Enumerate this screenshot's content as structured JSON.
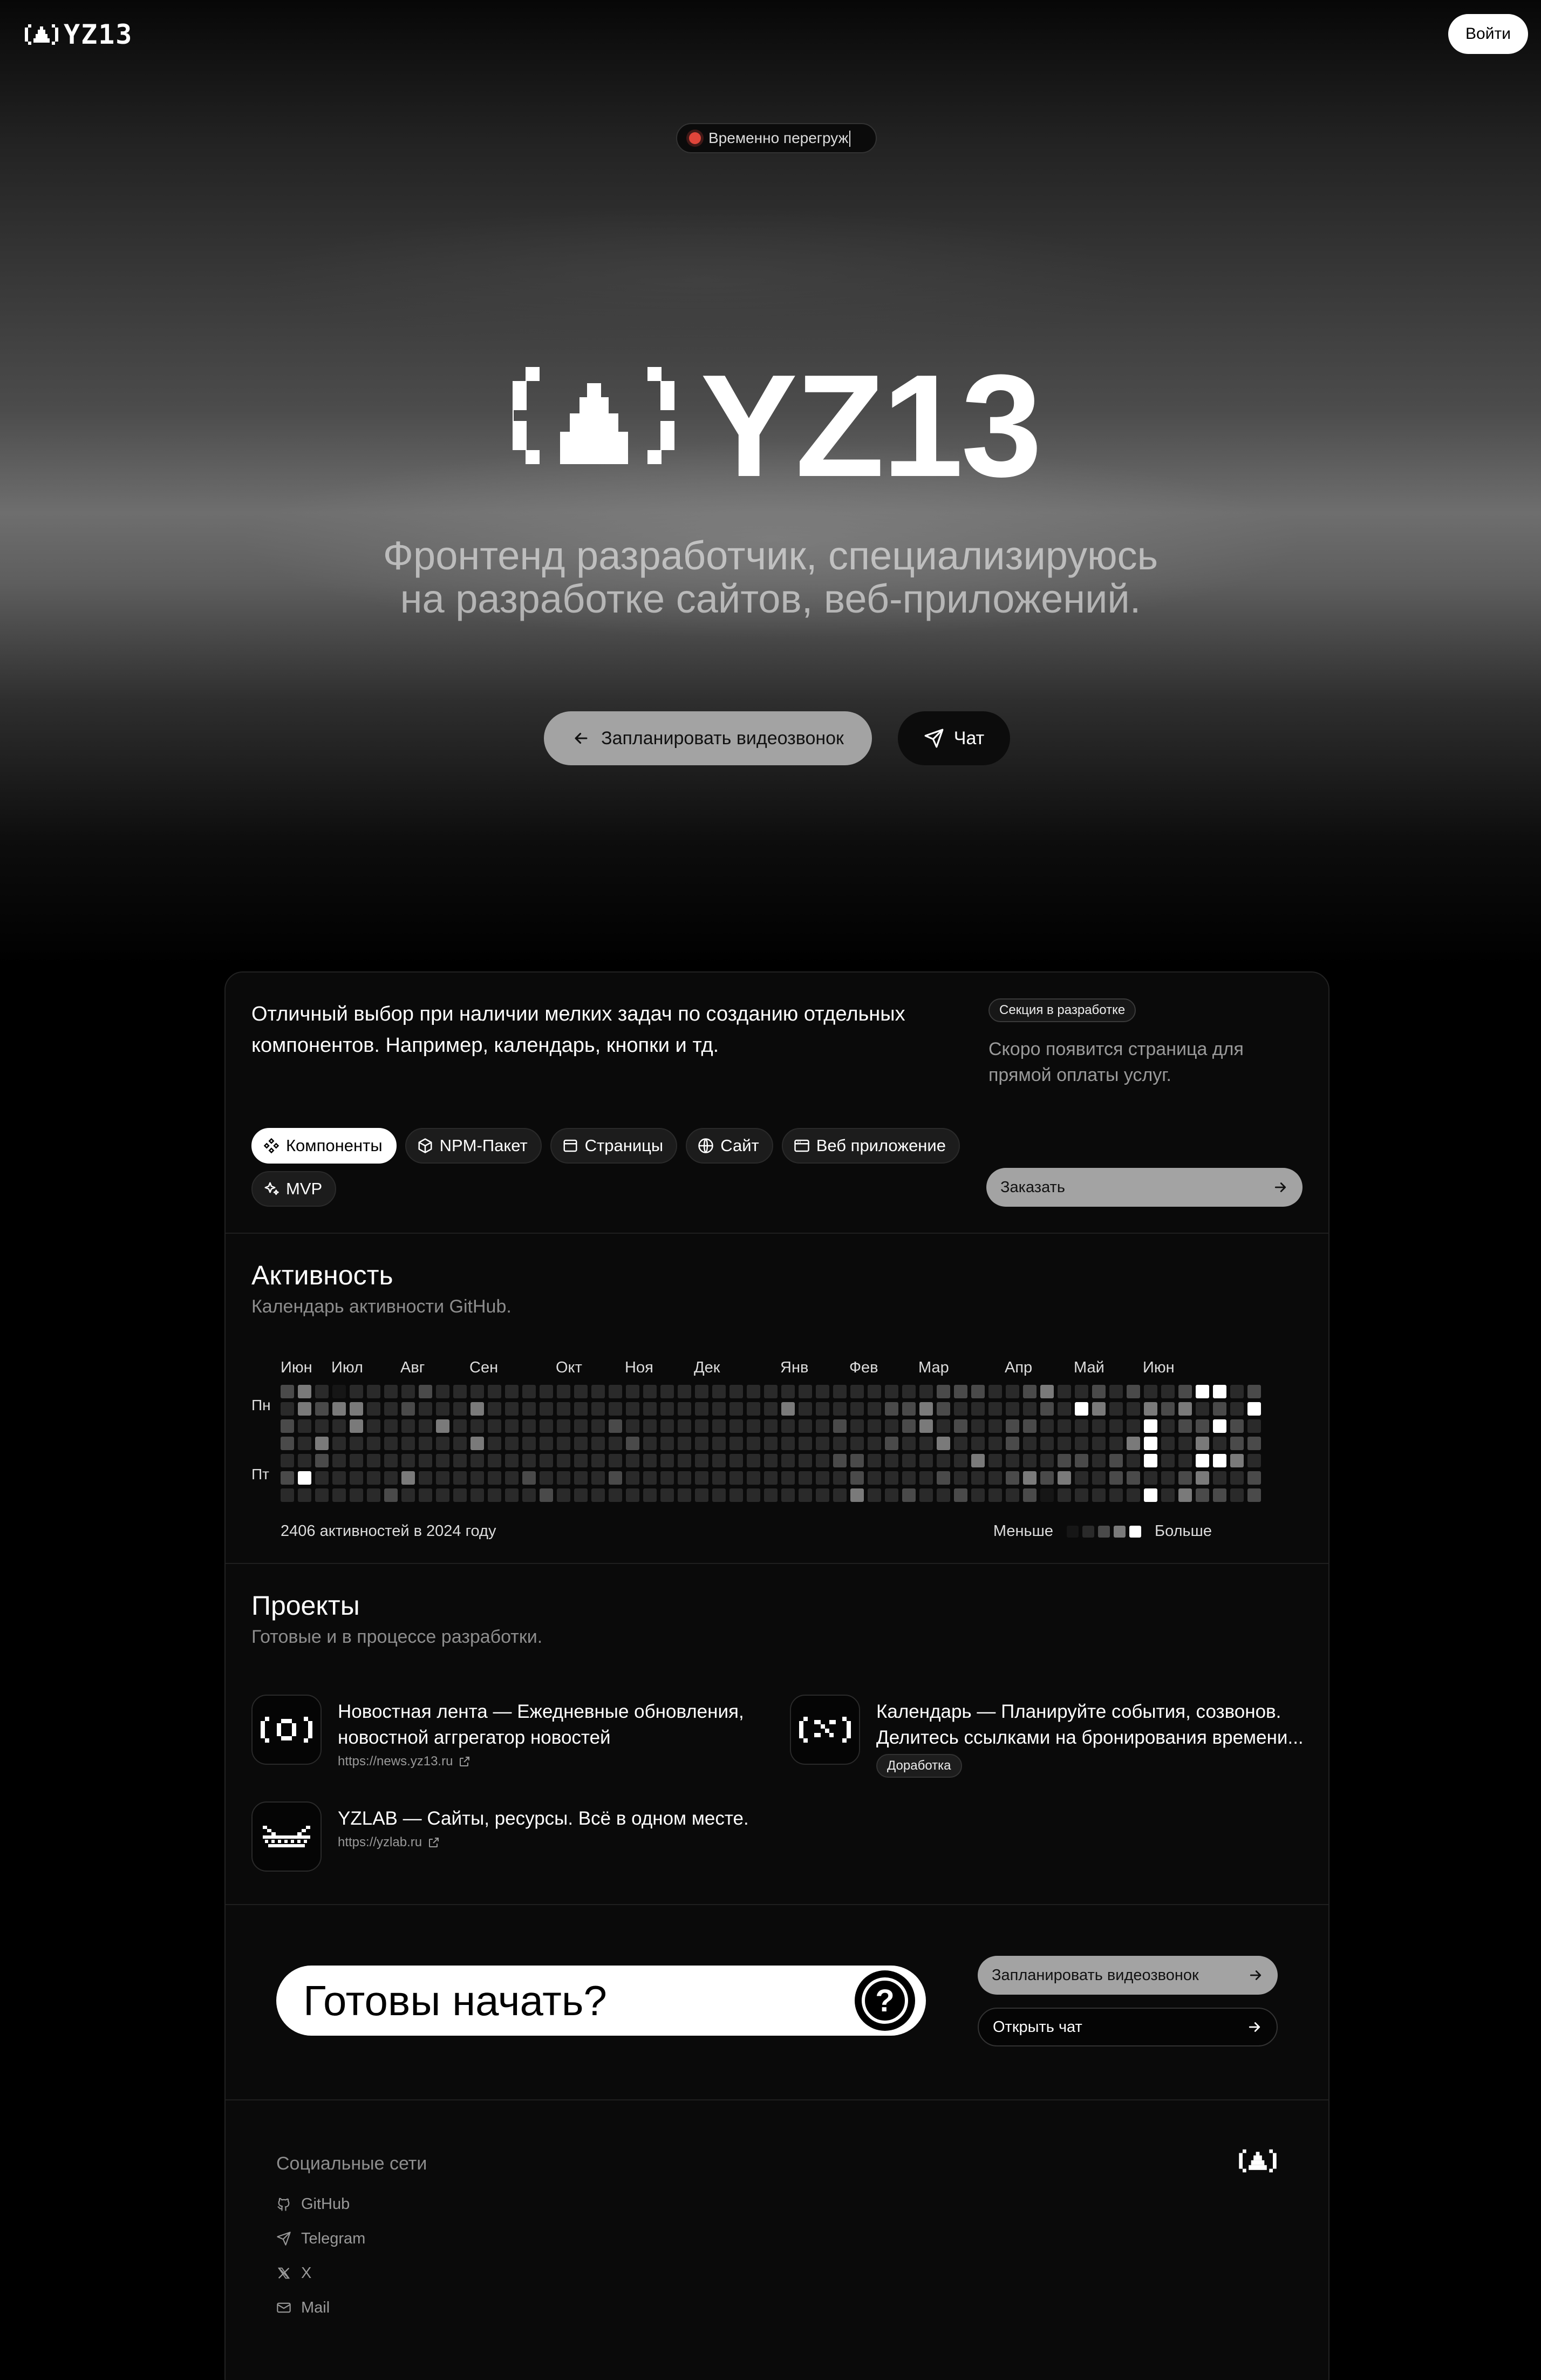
{
  "header": {
    "logo_text": "YZ13",
    "login_label": "Войти"
  },
  "hero": {
    "status_text": "Временно перегруж",
    "status_color": "#e0453a",
    "title": "YZ13",
    "subtitle_line1": "Фронтенд разработчик, специализируюсь",
    "subtitle_line2": "на разработке сайтов, веб-приложений.",
    "cta_primary": "Запланировать видеозвонок",
    "cta_chat": "Чат"
  },
  "offer": {
    "description": "Отличный выбор при наличии мелких задач по созданию отдельных компонентов. Например, календарь, кнопки и тд.",
    "badge": "Секция в разработке",
    "note": "Скоро появится страница для прямой оплаты услуг.",
    "order_label": "Заказать",
    "chips": [
      {
        "label": "Компоненты",
        "icon": "components-icon",
        "active": true
      },
      {
        "label": "NPM-Пакет",
        "icon": "package-icon",
        "active": false
      },
      {
        "label": "Страницы",
        "icon": "pages-icon",
        "active": false
      },
      {
        "label": "Сайт",
        "icon": "globe-icon",
        "active": false
      },
      {
        "label": "Веб приложение",
        "icon": "app-window-icon",
        "active": false
      },
      {
        "label": "MVP",
        "icon": "sparkles-icon",
        "active": false
      }
    ]
  },
  "activity": {
    "title": "Активность",
    "subtitle": "Календарь активности GitHub.",
    "months": [
      "Июн",
      "Июл",
      "Авг",
      "Сен",
      "Окт",
      "Ноя",
      "Дек",
      "Янв",
      "Фев",
      "Мар",
      "Апр",
      "Май",
      "Июн"
    ],
    "day_labels": [
      "Пн",
      "Пт"
    ],
    "total_text": "2406 активностей в 2024 году",
    "legend_less": "Меньше",
    "legend_more": "Больше",
    "level_colors": [
      "#161616",
      "#2a2a2a",
      "#4a4a4a",
      "#7a7a7a",
      "#ffffff"
    ],
    "weeks": [
      [
        2,
        1,
        2,
        2,
        1,
        2,
        1
      ],
      [
        3,
        3,
        1,
        1,
        1,
        4,
        1
      ],
      [
        1,
        2,
        1,
        3,
        2,
        1,
        1
      ],
      [
        0,
        3,
        1,
        1,
        1,
        1,
        1
      ],
      [
        1,
        3,
        3,
        1,
        1,
        1,
        1
      ],
      [
        1,
        1,
        1,
        1,
        1,
        1,
        1
      ],
      [
        1,
        1,
        1,
        1,
        1,
        1,
        2
      ],
      [
        1,
        2,
        1,
        1,
        1,
        3,
        1
      ],
      [
        2,
        1,
        1,
        1,
        1,
        1,
        1
      ],
      [
        1,
        1,
        3,
        1,
        1,
        1,
        1
      ],
      [
        1,
        1,
        1,
        1,
        1,
        1,
        1
      ],
      [
        1,
        3,
        1,
        3,
        1,
        1,
        1
      ],
      [
        1,
        1,
        1,
        1,
        1,
        1,
        1
      ],
      [
        1,
        1,
        1,
        1,
        1,
        1,
        1
      ],
      [
        1,
        1,
        1,
        1,
        1,
        2,
        1
      ],
      [
        1,
        1,
        1,
        1,
        1,
        1,
        2
      ],
      [
        1,
        1,
        1,
        1,
        1,
        1,
        1
      ],
      [
        1,
        1,
        1,
        1,
        1,
        1,
        1
      ],
      [
        1,
        1,
        1,
        1,
        1,
        1,
        1
      ],
      [
        1,
        1,
        2,
        1,
        1,
        2,
        1
      ],
      [
        1,
        1,
        1,
        2,
        1,
        1,
        1
      ],
      [
        1,
        1,
        1,
        1,
        1,
        1,
        1
      ],
      [
        1,
        1,
        1,
        1,
        1,
        1,
        1
      ],
      [
        1,
        1,
        1,
        1,
        1,
        1,
        1
      ],
      [
        1,
        1,
        1,
        1,
        1,
        1,
        1
      ],
      [
        1,
        1,
        1,
        1,
        1,
        1,
        1
      ],
      [
        1,
        1,
        1,
        1,
        1,
        1,
        1
      ],
      [
        1,
        1,
        1,
        1,
        1,
        1,
        1
      ],
      [
        1,
        1,
        1,
        1,
        1,
        1,
        1
      ],
      [
        1,
        3,
        1,
        1,
        1,
        1,
        1
      ],
      [
        1,
        1,
        1,
        1,
        1,
        1,
        1
      ],
      [
        1,
        1,
        1,
        1,
        1,
        1,
        1
      ],
      [
        1,
        1,
        2,
        1,
        2,
        1,
        1
      ],
      [
        1,
        1,
        1,
        1,
        2,
        2,
        3
      ],
      [
        1,
        1,
        1,
        1,
        1,
        1,
        1
      ],
      [
        1,
        2,
        1,
        2,
        1,
        1,
        1
      ],
      [
        1,
        2,
        2,
        1,
        1,
        1,
        2
      ],
      [
        1,
        3,
        3,
        1,
        1,
        1,
        1
      ],
      [
        2,
        2,
        1,
        3,
        1,
        2,
        1
      ],
      [
        2,
        1,
        2,
        1,
        1,
        1,
        2
      ],
      [
        2,
        1,
        1,
        1,
        3,
        1,
        1
      ],
      [
        1,
        1,
        1,
        1,
        1,
        1,
        1
      ],
      [
        1,
        1,
        2,
        2,
        1,
        2,
        1
      ],
      [
        2,
        1,
        2,
        1,
        1,
        3,
        2
      ],
      [
        3,
        2,
        1,
        1,
        1,
        2,
        0
      ],
      [
        1,
        1,
        1,
        1,
        2,
        3,
        1
      ],
      [
        1,
        4,
        1,
        1,
        2,
        1,
        1
      ],
      [
        2,
        3,
        1,
        1,
        1,
        1,
        1
      ],
      [
        1,
        1,
        1,
        1,
        2,
        2,
        1
      ],
      [
        2,
        1,
        1,
        3,
        1,
        2,
        1
      ],
      [
        1,
        3,
        4,
        4,
        4,
        1,
        4
      ],
      [
        1,
        2,
        1,
        1,
        1,
        1,
        1
      ],
      [
        2,
        3,
        2,
        1,
        1,
        2,
        3
      ],
      [
        4,
        1,
        2,
        3,
        4,
        3,
        2
      ],
      [
        4,
        2,
        4,
        1,
        4,
        1,
        2
      ],
      [
        1,
        1,
        2,
        2,
        3,
        1,
        1
      ],
      [
        2,
        4,
        1,
        2,
        1,
        2,
        2
      ]
    ]
  },
  "projects": {
    "title": "Проекты",
    "subtitle": "Готовые и в процессе разработки.",
    "items": [
      {
        "title": "Новостная лента",
        "sep": "—",
        "desc_1": "Ежедневные обновления,",
        "desc_2": "новостной аггрегатор новостей",
        "link": "https://news.yz13.ru",
        "icon": "news-logo-icon"
      },
      {
        "title": "Календарь",
        "sep": "—",
        "desc_1": "Планируйте события, созвонов.",
        "desc_2": "Делитесь ссылками на бронирования времени...",
        "badge": "Доработка",
        "icon": "calendar-logo-icon"
      },
      {
        "title": "YZLAB",
        "sep": "—",
        "desc_1": "Сайты, ресурсы. Всё в одном месте.",
        "link": "https://yzlab.ru",
        "icon": "yzlab-logo-icon"
      }
    ]
  },
  "cta": {
    "ready_text": "Готовы начать?",
    "schedule_label": "Запланировать видеозвонок",
    "chat_label": "Открыть чат"
  },
  "footer": {
    "social_title": "Социальные сети",
    "links": [
      {
        "label": "GitHub",
        "icon": "github-icon"
      },
      {
        "label": "Telegram",
        "icon": "telegram-icon"
      },
      {
        "label": "X",
        "icon": "x-icon"
      },
      {
        "label": "Mail",
        "icon": "mail-icon"
      }
    ]
  }
}
